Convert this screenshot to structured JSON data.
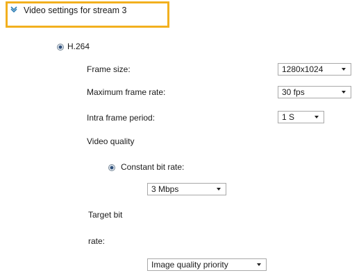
{
  "section": {
    "title": "Video settings for stream 3",
    "icon": "chevron-down-icon",
    "accent_color": "#f2b01e"
  },
  "codec": {
    "label": "H.264",
    "selected": true
  },
  "frame_size": {
    "label": "Frame size:",
    "value": "1280x1024"
  },
  "max_frame_rate": {
    "label": "Maximum frame rate:",
    "value": "30 fps"
  },
  "intra_frame": {
    "label": "Intra frame period:",
    "value": "1 S"
  },
  "video_quality": {
    "label": "Video quality"
  },
  "constant_bit_rate": {
    "label": "Constant bit rate:",
    "selected": true
  },
  "bit_rate": {
    "value": "3 Mbps"
  },
  "target_bit_rate": {
    "label_line1": "Target bit",
    "label_line2": "rate:",
    "value": "Image quality priority"
  }
}
